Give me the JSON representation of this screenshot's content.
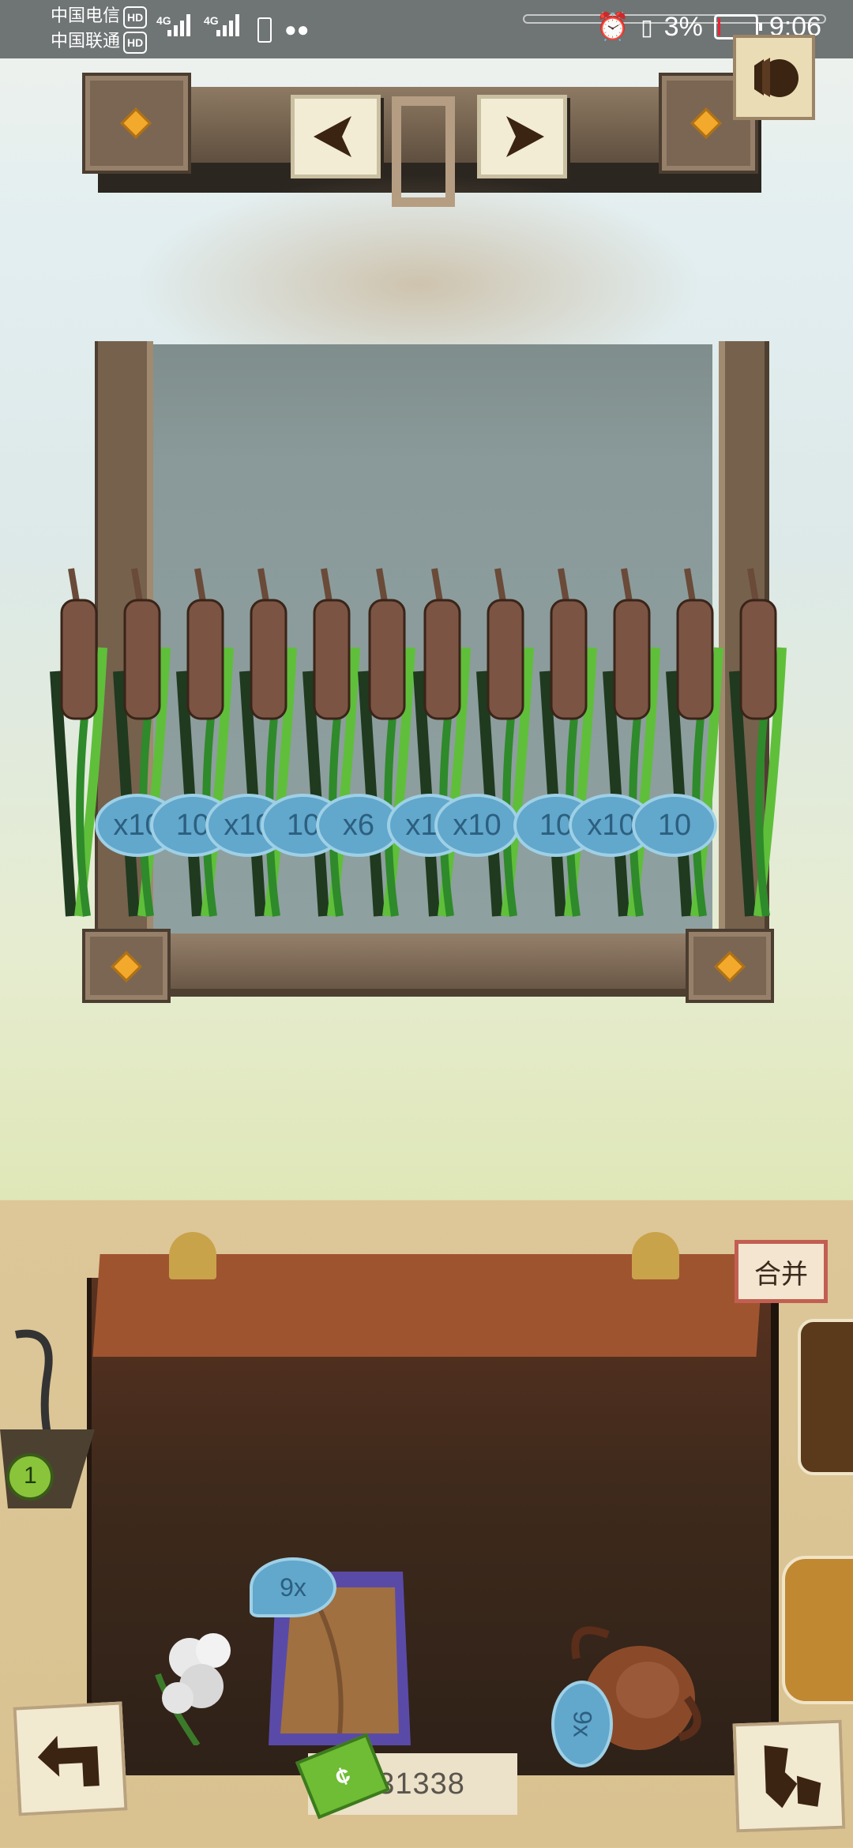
{
  "status_bar": {
    "carrier_1": "中国电信",
    "carrier_2": "中国联通",
    "hd": "HD",
    "network_1": "4G",
    "network_2": "4G",
    "battery": "3%",
    "time": "9:06",
    "icons": [
      "signal-icon",
      "battery-outline-icon",
      "wechat-icon",
      "alarm-icon",
      "vibrate-icon"
    ]
  },
  "top_nav": {
    "prev_icon": "arrow-left-icon",
    "next_icon": "arrow-right-icon",
    "coin_icon": "coin-stack-icon"
  },
  "reeds": {
    "badges": [
      "x10",
      "10",
      "x10",
      "10",
      "x6",
      "x10",
      "x10",
      "10",
      "x10",
      "10"
    ],
    "item_icon": "cattail-icon"
  },
  "bag": {
    "merge_label": "合并",
    "items": [
      {
        "name": "cotton-flower-icon",
        "count": ""
      },
      {
        "name": "sack-icon",
        "count": "9x"
      },
      {
        "name": "clay-pot-icon",
        "count": "9x"
      }
    ],
    "side_left_count": "1"
  },
  "footer": {
    "money": "231338",
    "cash_symbol": "¢",
    "back_icon": "back-arrow-icon",
    "map_icon": "map-icon"
  },
  "colors": {
    "badge_blue": "#62a7cc",
    "wood_dark": "#4b3d30",
    "bag_orange": "#9f5430",
    "merge_border": "#c25e52"
  }
}
